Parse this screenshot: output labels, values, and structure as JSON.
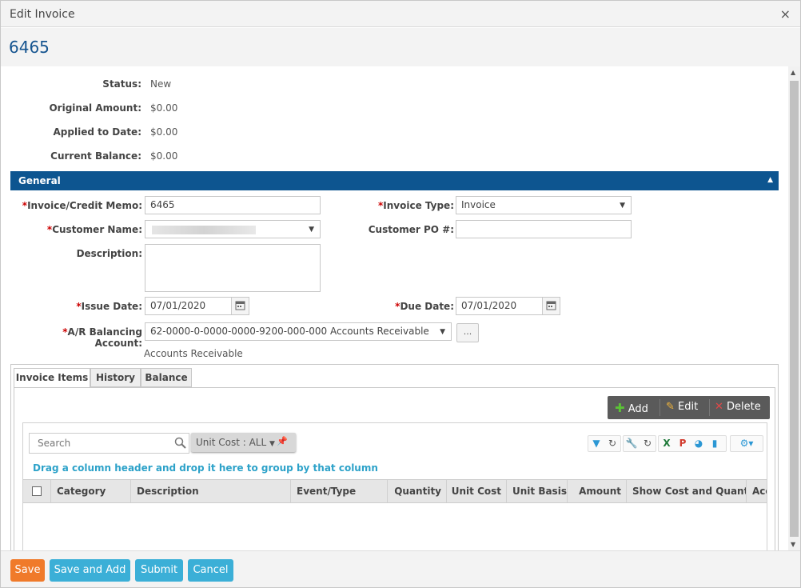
{
  "dialog": {
    "title": "Edit Invoice",
    "close_glyph": "×"
  },
  "record": {
    "number": "6465"
  },
  "summary": {
    "status_label": "Status:",
    "status_value": "New",
    "original_label": "Original Amount:",
    "original_value": "$0.00",
    "applied_label": "Applied to Date:",
    "applied_value": "$0.00",
    "balance_label": "Current Balance:",
    "balance_value": "$0.00"
  },
  "section": {
    "title": "General"
  },
  "form": {
    "required_mark": "*",
    "invoice_memo_label": "Invoice/Credit Memo:",
    "invoice_memo_value": "6465",
    "invoice_type_label": "Invoice Type:",
    "invoice_type_value": "Invoice",
    "customer_name_label": "Customer Name:",
    "customer_po_label": "Customer PO #:",
    "customer_po_value": "",
    "description_label": "Description:",
    "description_value": "",
    "issue_date_label": "Issue Date:",
    "issue_date_value": "07/01/2020",
    "due_date_label": "Due Date:",
    "due_date_value": "07/01/2020",
    "ar_account_label": "A/R Balancing Account:",
    "ar_account_value": "62-0000-0-0000-0000-9200-000-000 Accounts Receivable",
    "ar_account_desc": "Accounts Receivable",
    "ellipsis": "..."
  },
  "tabs": [
    {
      "label": "Invoice Items"
    },
    {
      "label": "History"
    },
    {
      "label": "Balance"
    }
  ],
  "toolbar": {
    "add": "Add",
    "edit": "Edit",
    "delete": "Delete"
  },
  "grid": {
    "search_placeholder": "Search",
    "filter_chip": "Unit Cost : ALL",
    "group_hint": "Drag a column header and drop it here to group by that column",
    "columns": [
      "Category",
      "Description",
      "Event/Type",
      "Quantity",
      "Unit Cost",
      "Unit Basis",
      "Amount",
      "Show Cost and Quant...",
      "Acc"
    ]
  },
  "footer": {
    "save": "Save",
    "save_add": "Save and Add",
    "submit": "Submit",
    "cancel": "Cancel"
  },
  "colors": {
    "brand": "#0d5590",
    "save": "#f07a2a",
    "action": "#3bafd7"
  }
}
